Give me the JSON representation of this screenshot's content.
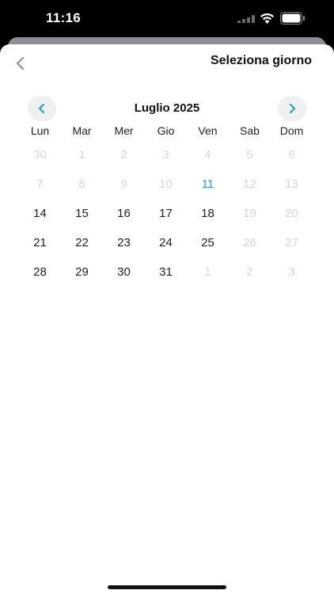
{
  "status_bar": {
    "time": "11:16"
  },
  "header": {
    "title": "Seleziona giorno",
    "back_icon": "chevron-left-icon"
  },
  "calendar": {
    "month_label": "Luglio 2025",
    "weekdays": [
      "Lun",
      "Mar",
      "Mer",
      "Gio",
      "Ven",
      "Sab",
      "Dom"
    ],
    "weeks": [
      [
        {
          "d": "30",
          "state": "muted"
        },
        {
          "d": "1",
          "state": "muted"
        },
        {
          "d": "2",
          "state": "muted"
        },
        {
          "d": "3",
          "state": "muted"
        },
        {
          "d": "4",
          "state": "muted"
        },
        {
          "d": "5",
          "state": "muted"
        },
        {
          "d": "6",
          "state": "muted"
        }
      ],
      [
        {
          "d": "7",
          "state": "muted"
        },
        {
          "d": "8",
          "state": "muted"
        },
        {
          "d": "9",
          "state": "muted"
        },
        {
          "d": "10",
          "state": "muted"
        },
        {
          "d": "11",
          "state": "today"
        },
        {
          "d": "12",
          "state": "muted"
        },
        {
          "d": "13",
          "state": "muted"
        }
      ],
      [
        {
          "d": "14",
          "state": "active"
        },
        {
          "d": "15",
          "state": "active"
        },
        {
          "d": "16",
          "state": "active"
        },
        {
          "d": "17",
          "state": "active"
        },
        {
          "d": "18",
          "state": "active"
        },
        {
          "d": "19",
          "state": "muted"
        },
        {
          "d": "20",
          "state": "muted"
        }
      ],
      [
        {
          "d": "21",
          "state": "active"
        },
        {
          "d": "22",
          "state": "active"
        },
        {
          "d": "23",
          "state": "active"
        },
        {
          "d": "24",
          "state": "active"
        },
        {
          "d": "25",
          "state": "active"
        },
        {
          "d": "26",
          "state": "muted"
        },
        {
          "d": "27",
          "state": "muted"
        }
      ],
      [
        {
          "d": "28",
          "state": "active"
        },
        {
          "d": "29",
          "state": "active"
        },
        {
          "d": "30",
          "state": "active"
        },
        {
          "d": "31",
          "state": "active"
        },
        {
          "d": "1",
          "state": "muted"
        },
        {
          "d": "2",
          "state": "muted"
        },
        {
          "d": "3",
          "state": "muted"
        }
      ]
    ]
  },
  "colors": {
    "accent": "#1fa3c4",
    "muted": "#d3d6d9",
    "nav_bg": "#eef0f1"
  }
}
